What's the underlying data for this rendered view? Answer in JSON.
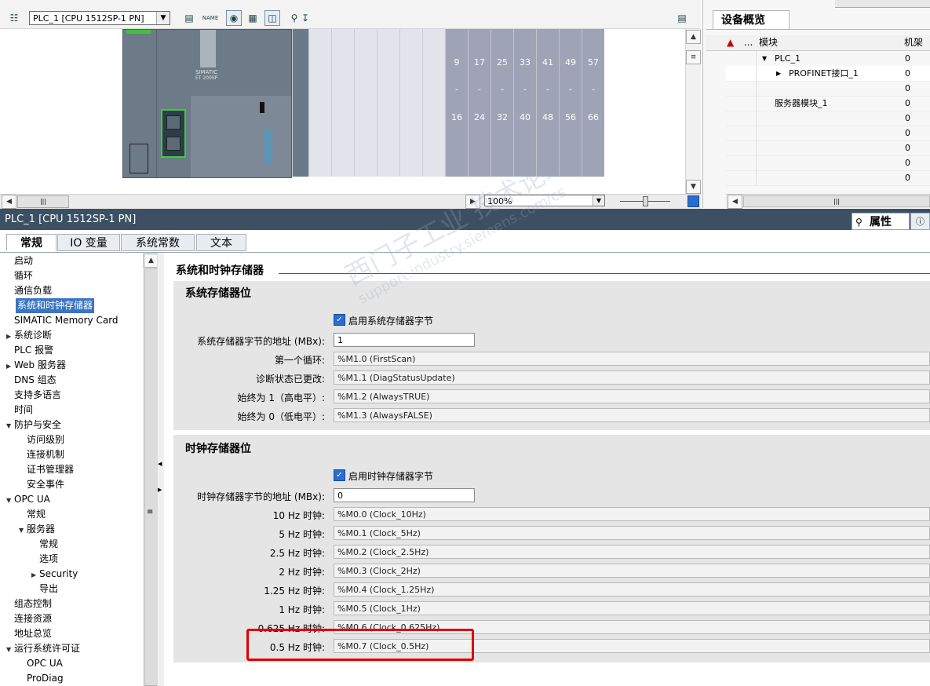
{
  "device_view": {
    "device_select": "PLC_1 [CPU 1512SP-1 PN]",
    "zoom": "100%",
    "slot_ranges": [
      {
        "from": "9",
        "sep": "-",
        "to": "16"
      },
      {
        "from": "17",
        "sep": "-",
        "to": "24"
      },
      {
        "from": "25",
        "sep": "-",
        "to": "32"
      },
      {
        "from": "33",
        "sep": "-",
        "to": "40"
      },
      {
        "from": "41",
        "sep": "-",
        "to": "48"
      },
      {
        "from": "49",
        "sep": "-",
        "to": "56"
      },
      {
        "from": "57",
        "sep": "-",
        "to": "66"
      }
    ],
    "module_brand": "SIMATIC",
    "module_model": "ET 200SP",
    "toolbar_icons": [
      "network-icon",
      "print-icon",
      "name-icon",
      "eye-icon",
      "grid-icon",
      "split-icon",
      "zoom-icon"
    ]
  },
  "overview": {
    "tab_title": "设备概览",
    "header_module": "模块",
    "header_rack": "机架",
    "header_dots": "...",
    "rows": [
      {
        "name": "PLC_1",
        "rack": "0",
        "indent": 1,
        "expanded": true
      },
      {
        "name": "PROFINET接口_1",
        "rack": "0",
        "indent": 2,
        "expanded": false
      },
      {
        "name": "",
        "rack": "0",
        "indent": 0
      },
      {
        "name": "服务器模块_1",
        "rack": "0",
        "indent": 1
      },
      {
        "name": "",
        "rack": "0",
        "indent": 0
      },
      {
        "name": "",
        "rack": "0",
        "indent": 0
      },
      {
        "name": "",
        "rack": "0",
        "indent": 0
      },
      {
        "name": "",
        "rack": "0",
        "indent": 0
      },
      {
        "name": "",
        "rack": "0",
        "indent": 0
      }
    ]
  },
  "status_bar": {
    "title": "PLC_1 [CPU 1512SP-1 PN]",
    "properties_tab": "属性"
  },
  "tabs": [
    "常规",
    "IO 变量",
    "系统常数",
    "文本"
  ],
  "nav": [
    {
      "label": "启动",
      "level": 0
    },
    {
      "label": "循环",
      "level": 0
    },
    {
      "label": "通信负载",
      "level": 0
    },
    {
      "label": "系统和时钟存储器",
      "level": 0,
      "selected": true
    },
    {
      "label": "SIMATIC Memory Card",
      "level": 0
    },
    {
      "label": "系统诊断",
      "level": 0,
      "arrow": "right"
    },
    {
      "label": "PLC 报警",
      "level": 0
    },
    {
      "label": "Web 服务器",
      "level": 0,
      "arrow": "right"
    },
    {
      "label": "DNS 组态",
      "level": 0
    },
    {
      "label": "支持多语言",
      "level": 0
    },
    {
      "label": "时间",
      "level": 0
    },
    {
      "label": "防护与安全",
      "level": 0,
      "arrow": "down"
    },
    {
      "label": "访问级别",
      "level": 1
    },
    {
      "label": "连接机制",
      "level": 1
    },
    {
      "label": "证书管理器",
      "level": 1
    },
    {
      "label": "安全事件",
      "level": 1
    },
    {
      "label": "OPC UA",
      "level": 0,
      "arrow": "down"
    },
    {
      "label": "常规",
      "level": 1
    },
    {
      "label": "服务器",
      "level": 1,
      "arrow": "down"
    },
    {
      "label": "常规",
      "level": 2
    },
    {
      "label": "选项",
      "level": 2
    },
    {
      "label": "Security",
      "level": 2,
      "arrow": "right"
    },
    {
      "label": "导出",
      "level": 2
    },
    {
      "label": "组态控制",
      "level": 0
    },
    {
      "label": "连接资源",
      "level": 0
    },
    {
      "label": "地址总览",
      "level": 0
    },
    {
      "label": "运行系统许可证",
      "level": 0,
      "arrow": "down"
    },
    {
      "label": "OPC UA",
      "level": 1
    },
    {
      "label": "ProDiag",
      "level": 1
    }
  ],
  "content": {
    "section_title": "系统和时钟存储器",
    "system_group": {
      "title": "系统存储器位",
      "enable_label": "启用系统存储器字节",
      "enabled": true,
      "address_label": "系统存储器字节的地址 (MBx):",
      "address_value": "1",
      "bits": [
        {
          "label": "第一个循环:",
          "value": "%M1.0 (FirstScan)"
        },
        {
          "label": "诊断状态已更改:",
          "value": "%M1.1 (DiagStatusUpdate)"
        },
        {
          "label": "始终为 1（高电平）:",
          "value": "%M1.2 (AlwaysTRUE)"
        },
        {
          "label": "始终为 0（低电平）:",
          "value": "%M1.3 (AlwaysFALSE)"
        }
      ]
    },
    "clock_group": {
      "title": "时钟存储器位",
      "enable_label": "启用时钟存储器字节",
      "enabled": true,
      "address_label": "时钟存储器字节的地址 (MBx):",
      "address_value": "0",
      "bits": [
        {
          "label": "10 Hz 时钟:",
          "value": "%M0.0 (Clock_10Hz)"
        },
        {
          "label": "5 Hz 时钟:",
          "value": "%M0.1 (Clock_5Hz)"
        },
        {
          "label": "2.5 Hz 时钟:",
          "value": "%M0.2 (Clock_2.5Hz)"
        },
        {
          "label": "2 Hz 时钟:",
          "value": "%M0.3 (Clock_2Hz)"
        },
        {
          "label": "1.25 Hz 时钟:",
          "value": "%M0.4 (Clock_1.25Hz)"
        },
        {
          "label": "1 Hz 时钟:",
          "value": "%M0.5 (Clock_1Hz)"
        },
        {
          "label": "0.625 Hz 时钟:",
          "value": "%M0.6 (Clock_0.625Hz)"
        },
        {
          "label": "0.5 Hz 时钟:",
          "value": "%M0.7 (Clock_0.5Hz)"
        }
      ]
    },
    "highlight_color": "#e00000"
  },
  "watermark": {
    "line1": "西门子工业 技术论坛",
    "line2": "support.industry.siemens.com/cs"
  }
}
